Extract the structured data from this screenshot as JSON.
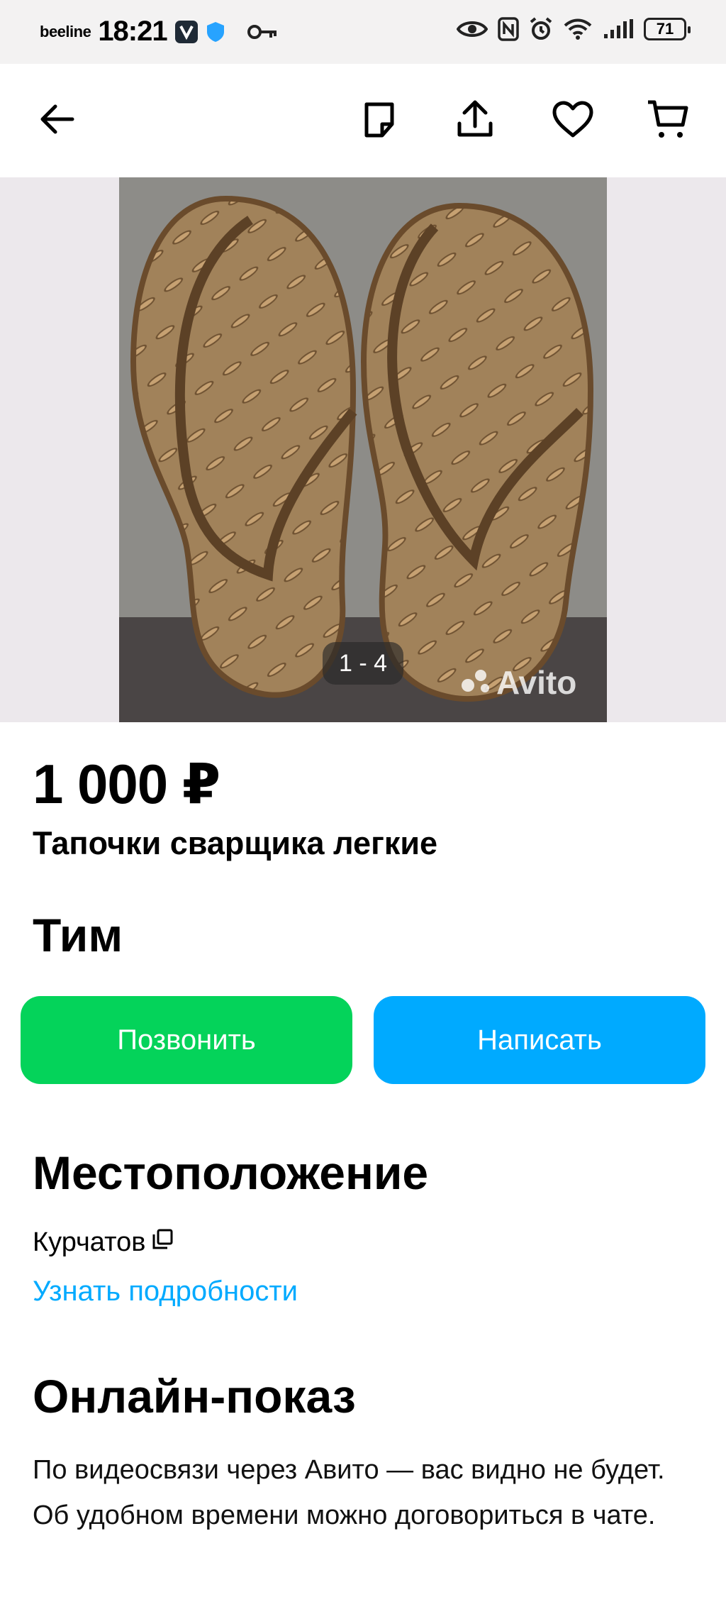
{
  "status_bar": {
    "carrier": "beeline",
    "time": "18:21",
    "battery": "71"
  },
  "gallery": {
    "counter": "1 - 4",
    "watermark": "Avito"
  },
  "listing": {
    "price": "1 000 ₽",
    "title": "Тапочки сварщика легкие",
    "seller": "Тим"
  },
  "actions": {
    "call_label": "Позвонить",
    "write_label": "Написать",
    "call_color": "#04d35a",
    "write_color": "#00aaff"
  },
  "location": {
    "heading": "Местоположение",
    "city": "Курчатов",
    "more_link": "Узнать подробности"
  },
  "online_show": {
    "heading": "Онлайн-показ",
    "text": "По видеосвязи через Авито — вас видно не будет. Об удобном времени можно договориться в чате."
  },
  "icons": {
    "back": "arrow-left-icon",
    "note": "note-icon",
    "share": "share-icon",
    "favorite": "heart-icon",
    "cart": "cart-icon",
    "copy": "copy-icon"
  }
}
